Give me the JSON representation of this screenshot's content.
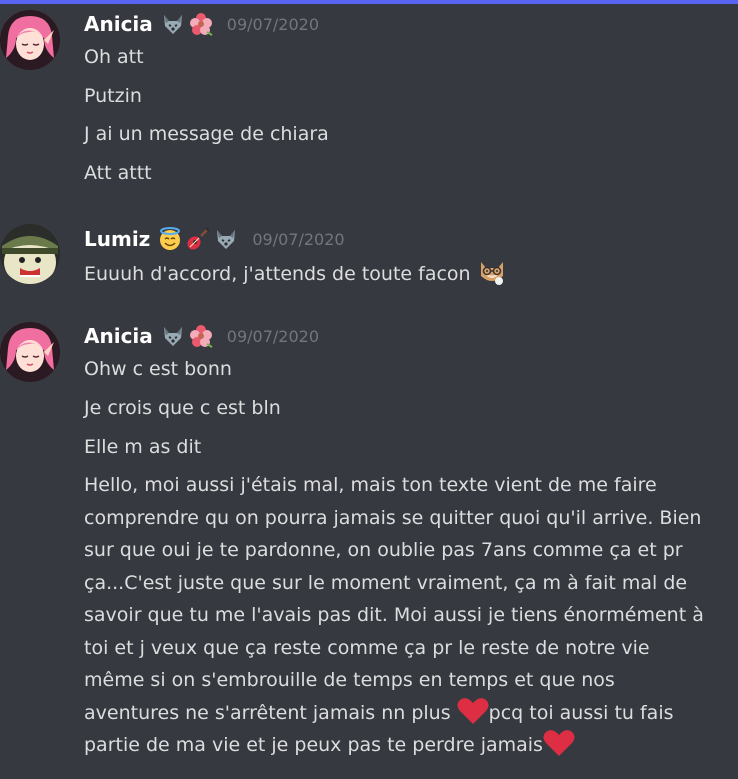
{
  "colors": {
    "background": "#36393f",
    "username": "#ffffff",
    "timestamp": "#72767d",
    "message_text": "#dcddde",
    "heart": "#dd2e44"
  },
  "groups": [
    {
      "username": "Anicia",
      "badges": [
        "wolf-emoji-icon",
        "hibiscus-emoji-icon"
      ],
      "timestamp": "09/07/2020",
      "messages": [
        "Oh att",
        "Putzin",
        "J ai un message de chiara",
        "Att attt"
      ]
    },
    {
      "username": "Lumiz",
      "badges": [
        "halo-smile-emoji-icon",
        "guitar-emoji-icon",
        "wolf-emoji-icon"
      ],
      "timestamp": "09/07/2020",
      "messages": [
        "Euuuh d'accord, j'attends de toute facon"
      ],
      "message_emoji": "cat-glasses-emoji-icon"
    },
    {
      "username": "Anicia",
      "badges": [
        "wolf-emoji-icon",
        "hibiscus-emoji-icon"
      ],
      "timestamp": "09/07/2020",
      "messages": [
        "Ohw c est bonn",
        "Je crois que c est bln",
        "Elle m as dit",
        "Hello, moi aussi j'étais mal, mais ton texte vient de me faire comprendre qu on pourra jamais se quitter quoi qu'il arrive. Bien sur que oui je te pardonne, on oublie pas 7ans comme ça et pr ça...C'est juste que sur le moment vraiment, ça m à fait mal de savoir que tu me l'avais pas dit. Moi aussi je tiens énormément à toi et j veux que ça reste comme ça pr le reste de notre vie même si on s'embrouille de temps en temps et que nos aventures ne s'arrêtent jamais nn plus"
      ],
      "long_message_part2": "pcq toi aussi tu fais partie de ma vie et je peux pas te perdre jamais",
      "heart_icon": "red-heart-emoji-icon"
    }
  ]
}
